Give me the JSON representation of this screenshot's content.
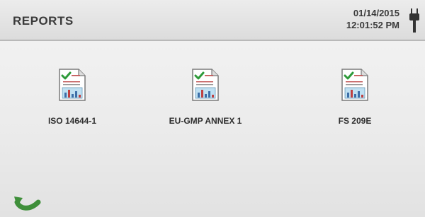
{
  "header": {
    "title": "REPORTS",
    "date": "01/14/2015",
    "time": "12:01:52 PM",
    "power_icon": "plug-icon"
  },
  "reports": [
    {
      "label": "ISO 14644-1",
      "icon": "report-document-icon"
    },
    {
      "label": "EU-GMP ANNEX 1",
      "icon": "report-document-icon"
    },
    {
      "label": "FS 209E",
      "icon": "report-document-icon"
    }
  ],
  "footer": {
    "back_icon": "back-arrow-icon"
  },
  "colors": {
    "header_bg": "#e4e4e4",
    "text": "#3a3a3a",
    "check_green": "#2e9a3a",
    "back_green": "#3f8f3a"
  }
}
